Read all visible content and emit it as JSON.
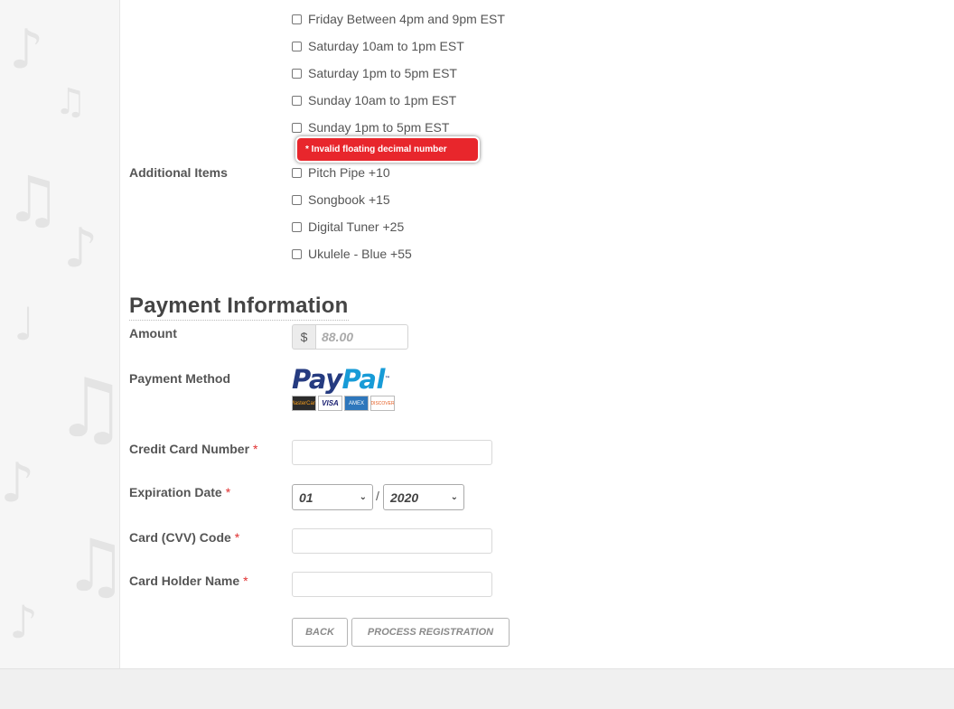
{
  "availability": {
    "options": [
      "Friday Between 4pm and 9pm EST",
      "Saturday 10am to 1pm EST",
      "Saturday 1pm to 5pm EST",
      "Sunday 10am to 1pm EST",
      "Sunday 1pm to 5pm EST"
    ]
  },
  "error": {
    "message": "* Invalid floating decimal number"
  },
  "additional_items": {
    "label": "Additional Items",
    "options": [
      "Pitch Pipe +10",
      "Songbook +15",
      "Digital Tuner +25",
      "Ukulele - Blue +55"
    ]
  },
  "payment": {
    "title": "Payment Information",
    "amount_label": "Amount",
    "currency_symbol": "$",
    "amount_placeholder": "88.00",
    "method_label": "Payment Method",
    "paypal": {
      "pay": "Pay",
      "pal": "Pal",
      "tm": "™"
    },
    "cards": [
      "MasterCard",
      "VISA",
      "AMEX",
      "DISCOVER"
    ],
    "card_number_label": "Credit Card Number",
    "expiration_label": "Expiration Date",
    "exp_month": "01",
    "exp_separator": "/",
    "exp_year": "2020",
    "cvv_label": "Card (CVV) Code",
    "holder_label": "Card Holder Name",
    "required_marker": "*"
  },
  "buttons": {
    "back": "BACK",
    "process": "PROCESS REGISTRATION"
  },
  "colors": {
    "error_bg": "#e8262c",
    "paypal_dark": "#253b80",
    "paypal_light": "#179bd7",
    "required": "#e03030"
  }
}
